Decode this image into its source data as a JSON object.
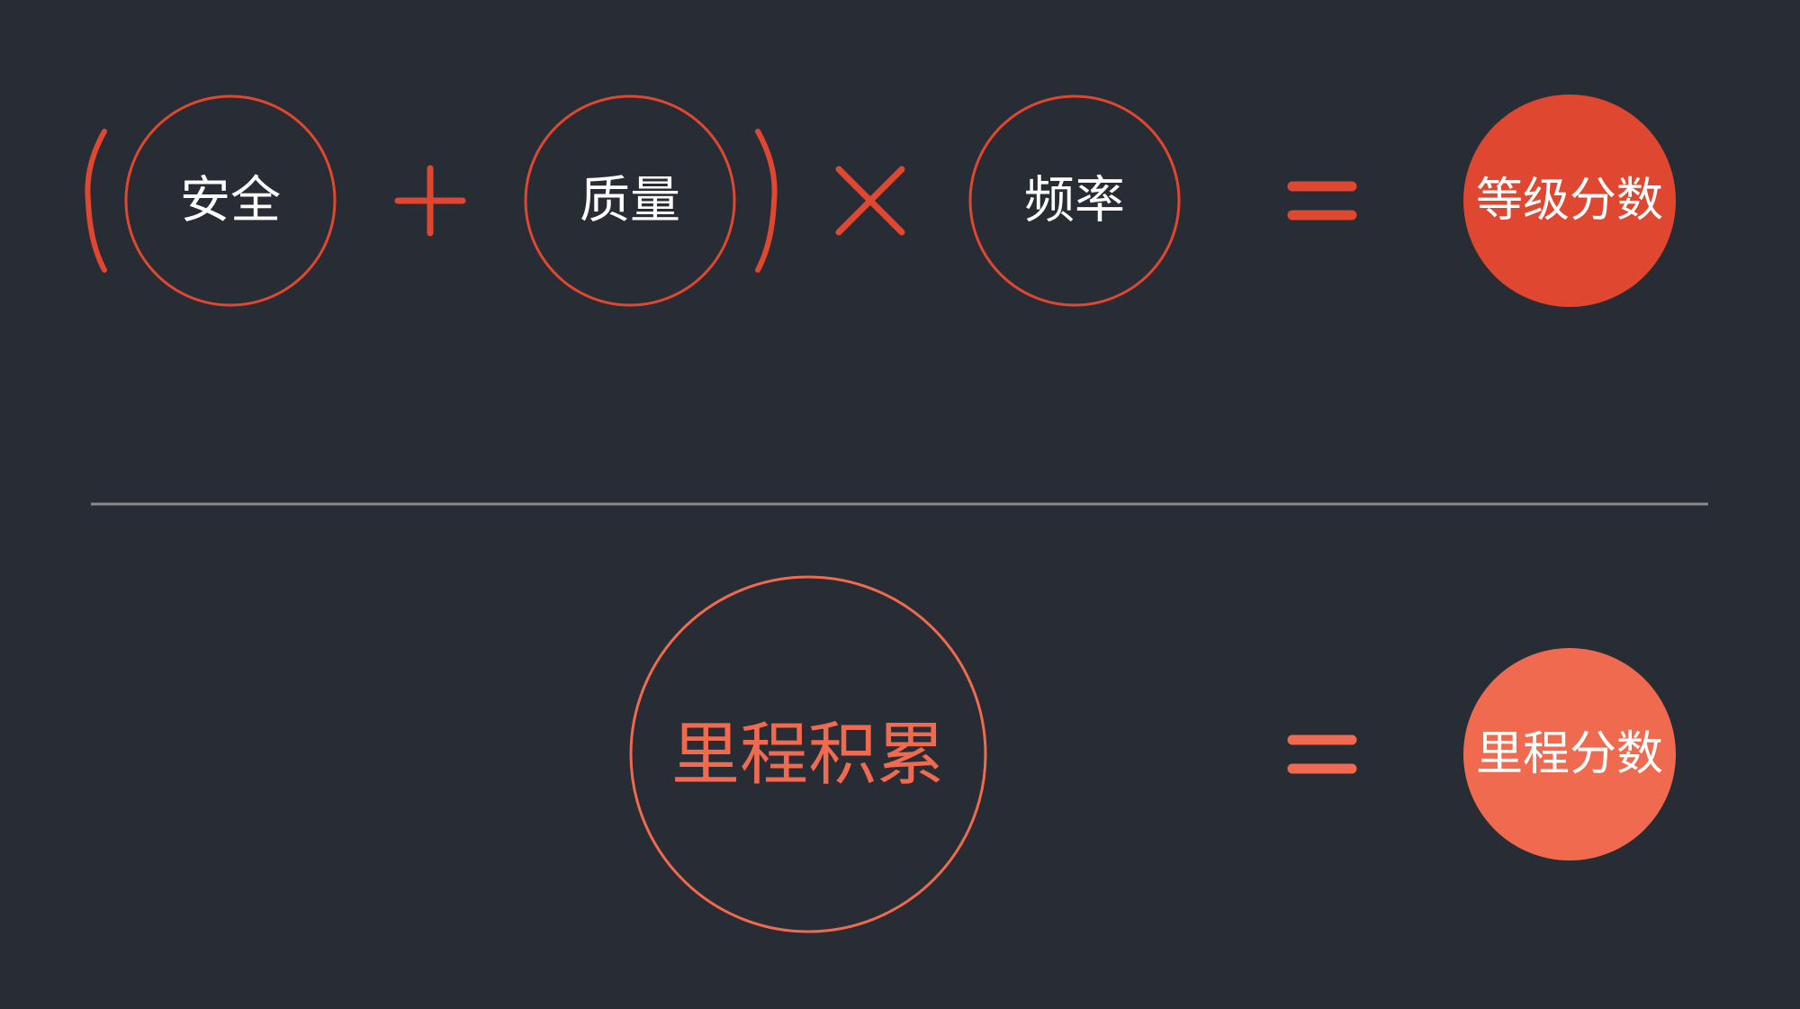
{
  "colors": {
    "background": "#282c34",
    "accent": "#e04730",
    "accent_light": "#f06a50",
    "text": "#ffffff",
    "divider": "#8a8a8a"
  },
  "formula_top": {
    "operand_safety": "安全",
    "operand_quality": "质量",
    "operand_frequency": "频率",
    "result_level_score": "等级分数"
  },
  "formula_bottom": {
    "operand_mileage_accumulation": "里程积累",
    "result_mileage_score": "里程分数"
  }
}
